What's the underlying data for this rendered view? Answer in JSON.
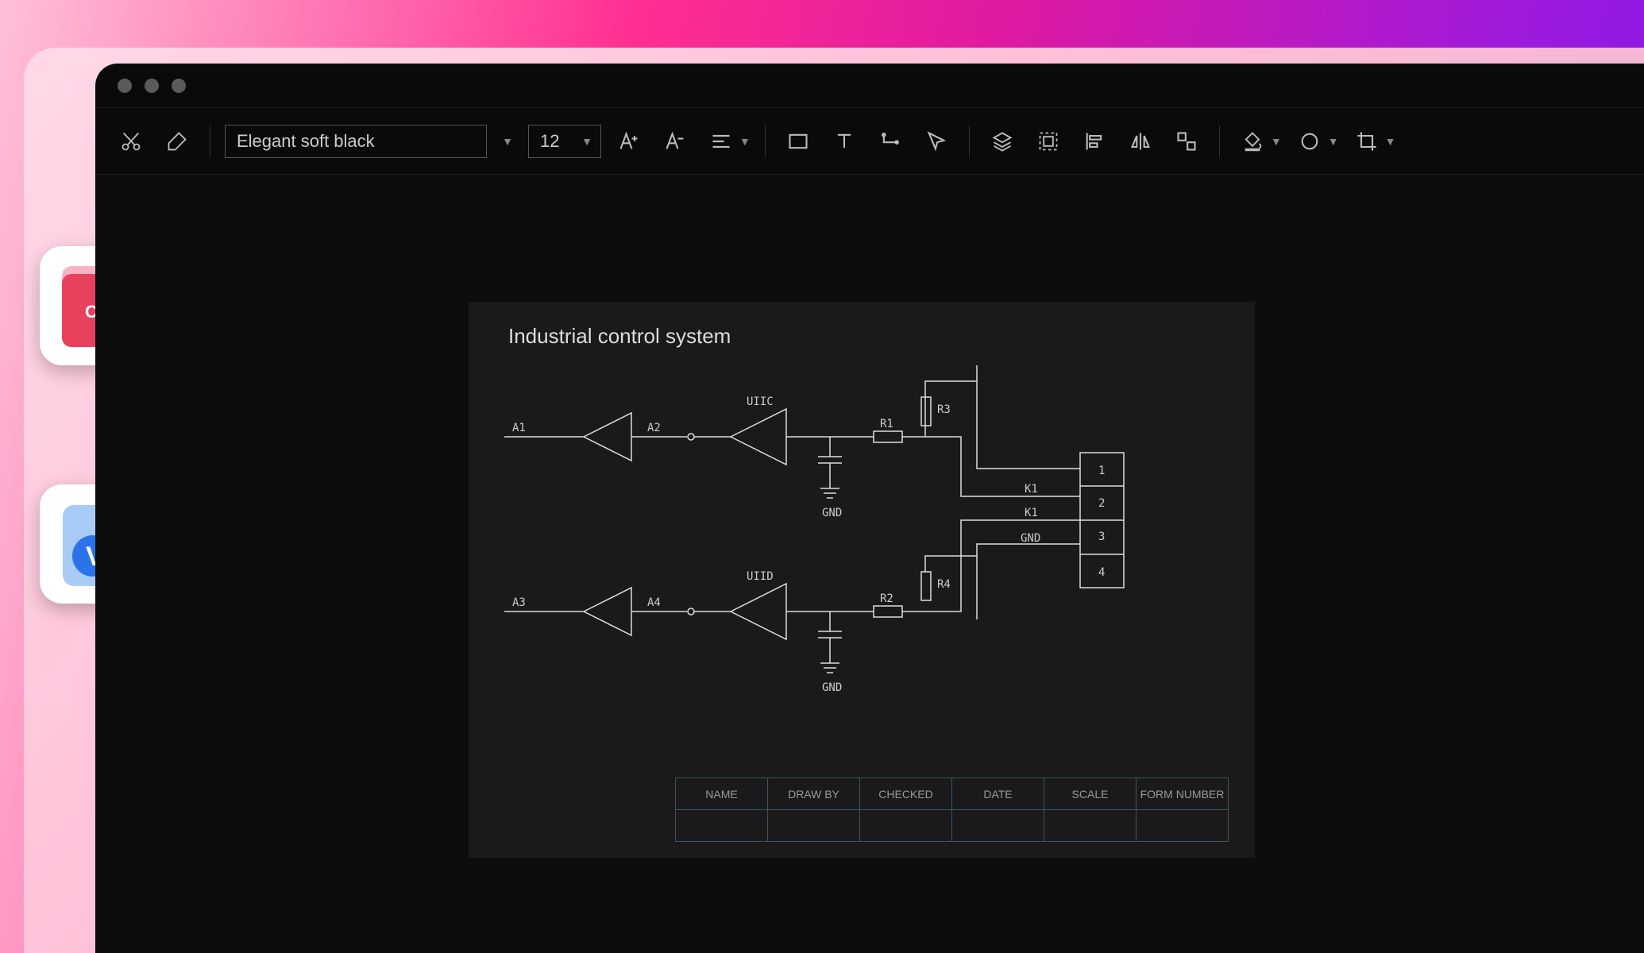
{
  "toolbar": {
    "font_name": "Elegant soft black",
    "font_size": "12"
  },
  "schematic": {
    "title": "Industrial control system",
    "labels": {
      "a1": "A1",
      "a2": "A2",
      "a3": "A3",
      "a4": "A4",
      "uiic": "UIIC",
      "uiid": "UIID",
      "r1": "R1",
      "r2": "R2",
      "r3": "R3",
      "r4": "R4",
      "k1a": "K1",
      "k1b": "K1",
      "gnd1": "GND",
      "gnd2": "GND",
      "gnd3": "GND",
      "pin1": "1",
      "pin2": "2",
      "pin3": "3",
      "pin4": "4"
    },
    "table_headers": [
      "NAME",
      "DRAW BY",
      "CHECKED",
      "DATE",
      "SCALE",
      "FORM NUMBER"
    ]
  },
  "file_icons": {
    "cad": "CAD",
    "visio": "V"
  }
}
